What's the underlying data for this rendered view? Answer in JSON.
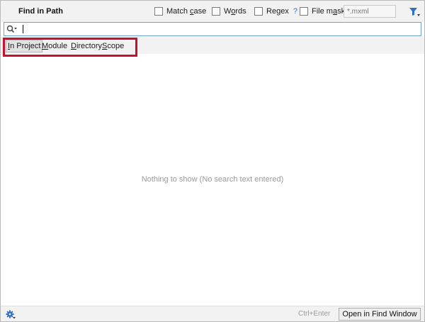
{
  "dialog": {
    "title": "Find in Path"
  },
  "options": {
    "match_case": {
      "label_pre": "Match ",
      "label_u": "c",
      "label_post": "ase",
      "checked": false
    },
    "words": {
      "label_pre": "W",
      "label_u": "o",
      "label_post": "rds",
      "checked": false
    },
    "regex": {
      "label_pre": "Re",
      "label_u": "g",
      "label_post": "ex",
      "help": "?",
      "checked": false
    },
    "file_mask": {
      "label_pre": "File m",
      "label_u": "a",
      "label_post": "sk:",
      "checked": false,
      "placeholder": "*.mxml"
    }
  },
  "search": {
    "value": ""
  },
  "scope_tabs": [
    {
      "label_pre": "",
      "label_u": "I",
      "label_post": "n Project",
      "active": true
    },
    {
      "label_pre": "",
      "label_u": "M",
      "label_post": "odule",
      "active": false
    },
    {
      "label_pre": "",
      "label_u": "D",
      "label_post": "irectory",
      "active": false
    },
    {
      "label_pre": "",
      "label_u": "S",
      "label_post": "cope",
      "active": false
    }
  ],
  "results": {
    "empty_message": "Nothing to show (No search text entered)"
  },
  "footer": {
    "shortcut": "Ctrl+Enter",
    "open_button": "Open in Find Window"
  },
  "colors": {
    "accent_blue": "#2e6fc7",
    "highlight_red": "#c8102e"
  }
}
